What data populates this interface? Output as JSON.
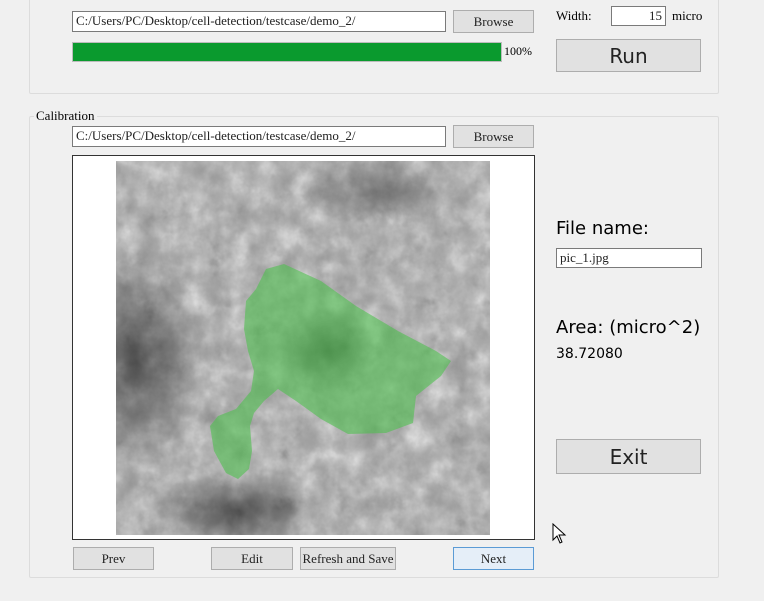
{
  "top": {
    "path": "C:/Users/PC/Desktop/cell-detection/testcase/demo_2/",
    "browse_label": "Browse",
    "progress_value": 1.0,
    "progress_text": "100%",
    "progress_color": "#0a9a2e",
    "width_label": "Width:",
    "width_value": "15",
    "width_unit": "micro",
    "run_label": "Run"
  },
  "calibration": {
    "title": "Calibration",
    "path": "C:/Users/PC/Desktop/cell-detection/testcase/demo_2/",
    "browse_label": "Browse",
    "overlay_color": "#4fbf4f",
    "file_name_label": "File name:",
    "file_name_value": "pic_1.jpg",
    "area_label": "Area: (micro^2)",
    "area_value": "38.72080",
    "exit_label": "Exit",
    "prev_label": "Prev",
    "edit_label": "Edit",
    "refresh_label": "Refresh and Save",
    "next_label": "Next"
  },
  "icons": {
    "cursor": "mouse-pointer-icon"
  }
}
